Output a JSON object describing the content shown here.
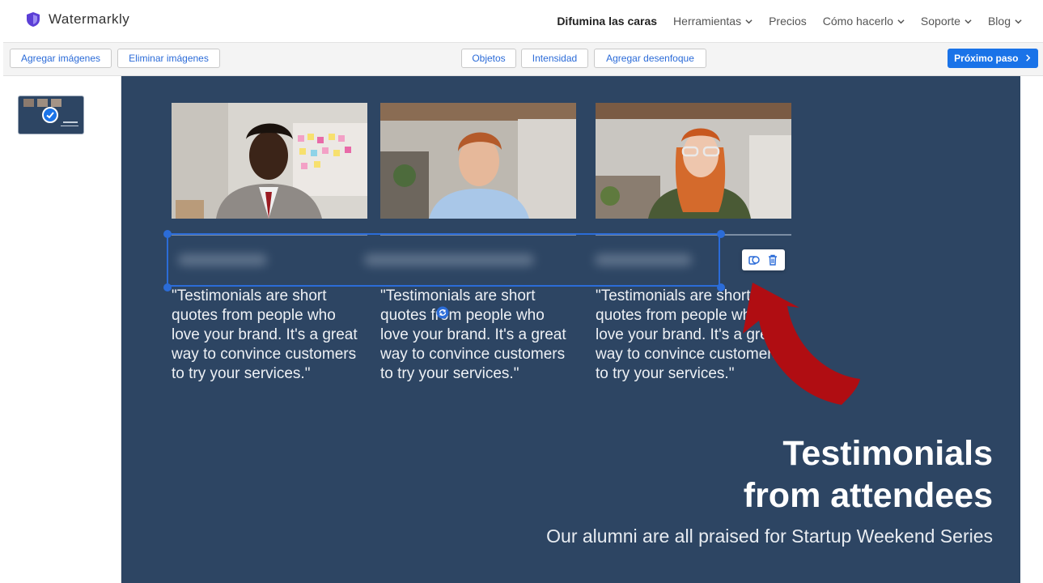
{
  "app": {
    "name": "Watermarkly"
  },
  "nav": {
    "items": [
      {
        "label": "Difumina las caras",
        "active": true,
        "dropdown": false
      },
      {
        "label": "Herramientas",
        "active": false,
        "dropdown": true
      },
      {
        "label": "Precios",
        "active": false,
        "dropdown": false
      },
      {
        "label": "Cómo hacerlo",
        "active": false,
        "dropdown": true
      },
      {
        "label": "Soporte",
        "active": false,
        "dropdown": true
      },
      {
        "label": "Blog",
        "active": false,
        "dropdown": true
      }
    ]
  },
  "toolbar": {
    "add_images": "Agregar imágenes",
    "remove_images": "Eliminar imágenes",
    "objects": "Objetos",
    "intensity": "Intensidad",
    "add_blur": "Agregar desenfoque",
    "next_step": "Próximo paso"
  },
  "slide": {
    "quotes": [
      "\"Testimonials are short quotes from people who love your brand. It's a great way to convince customers to try your services.\"",
      "\"Testimonials are short quotes from people who love your brand. It's a great way to convince customers to try your services.\"",
      "\"Testimonials are short quotes from people who love your brand. It's a great way to convince customers to try your services.\""
    ],
    "title_line1": "Testimonials",
    "title_line2": "from attendees",
    "subtitle": "Our alumni are all praised for Startup Weekend Series"
  },
  "colors": {
    "accent": "#1a73e8",
    "slide_bg": "#2d4563",
    "arrow": "#b00d12"
  },
  "icons": [
    "shield-logo-icon",
    "chevron-down-icon",
    "chevron-right-icon",
    "checkmark-icon",
    "duplicate-icon",
    "trash-icon",
    "rotate-icon",
    "arrow-pointer"
  ]
}
